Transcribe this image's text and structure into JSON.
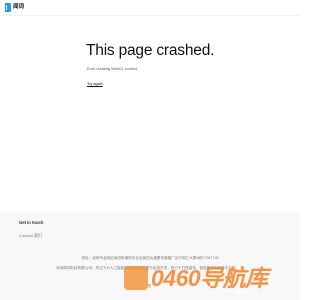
{
  "header": {
    "logo_text": "闻词",
    "logo_color": "#1e9be9"
  },
  "crash": {
    "title": "This page crashed.",
    "message": "Error creating WebGL context.",
    "try_again_label": "Try again"
  },
  "footer": {
    "heading": "Get in touch",
    "contact_label": "Contact 我们",
    "address": "地址：深圳市龙岗区坂田街道岗头社区坂田大道联华南路厂区中软汇大厦A栋2706T136",
    "company": "深圳闻词科技有限公司，专注于AI人工智能的深度文本处理与应用开发，致力于打造高效、智能的文字服务平台",
    "small_text": "所"
  },
  "watermark": {
    "text": "0460导航库",
    "color": "#f08020"
  }
}
